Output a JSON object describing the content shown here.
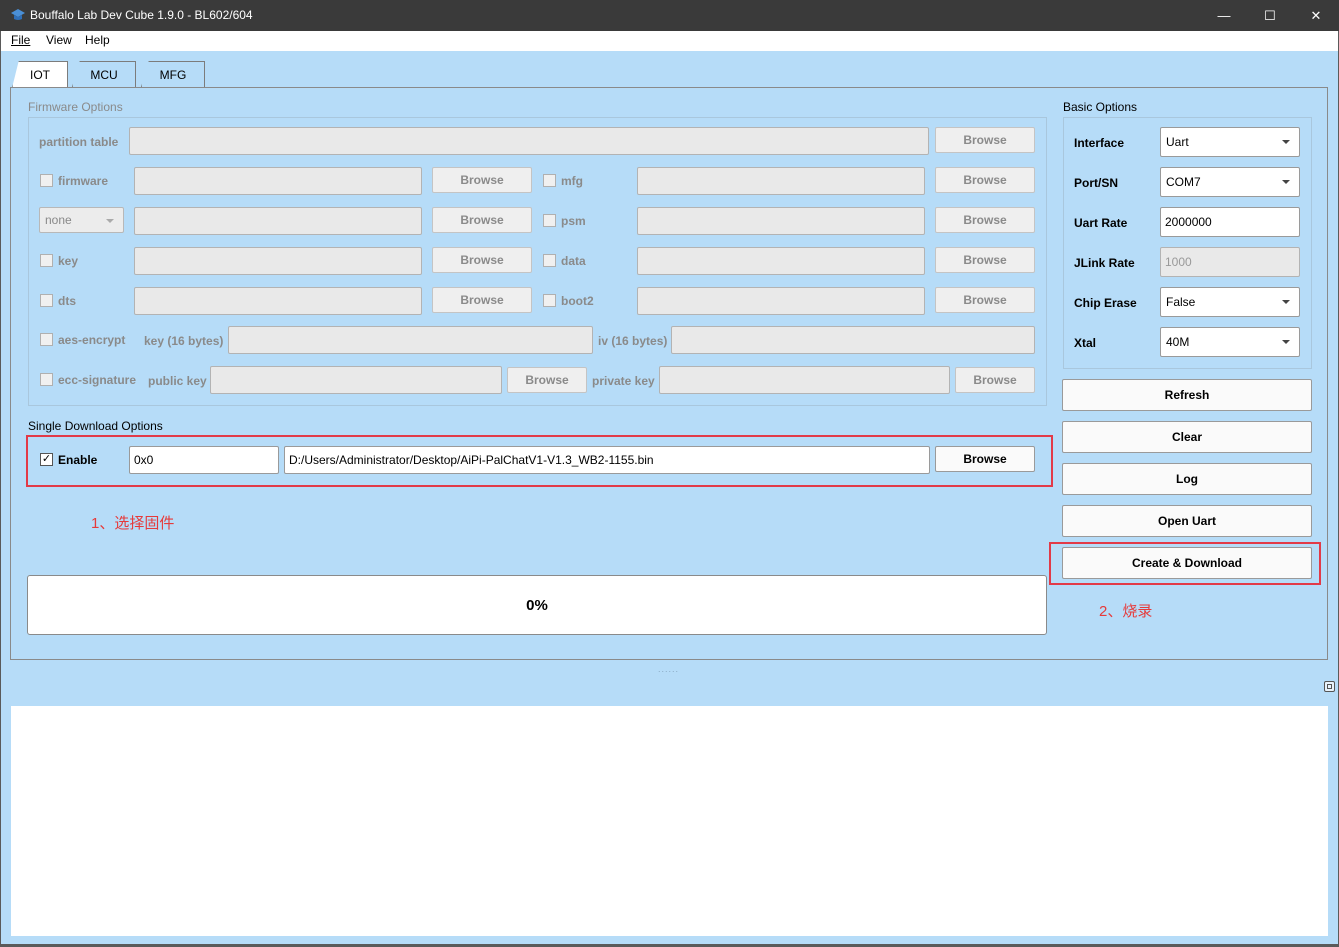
{
  "window": {
    "title": "Bouffalo Lab Dev Cube 1.9.0 - BL602/604",
    "minimize": "—",
    "maximize": "☐",
    "close": "✕"
  },
  "menu": {
    "file": "File",
    "view": "View",
    "help": "Help"
  },
  "tabs": [
    {
      "label": "IOT",
      "active": true
    },
    {
      "label": "MCU",
      "active": false
    },
    {
      "label": "MFG",
      "active": false
    }
  ],
  "firmware_options": {
    "title": "Firmware Options",
    "partition_table": {
      "label": "partition table",
      "value": "",
      "browse": "Browse"
    },
    "firmware": {
      "label": "firmware",
      "checked": false,
      "value": "",
      "browse": "Browse"
    },
    "mfg": {
      "label": "mfg",
      "checked": false,
      "value": "",
      "browse": "Browse"
    },
    "none_select": {
      "value": "none",
      "field": "",
      "browse": "Browse"
    },
    "psm": {
      "label": "psm",
      "checked": false,
      "value": "",
      "browse": "Browse"
    },
    "key": {
      "label": "key",
      "checked": false,
      "value": "",
      "browse": "Browse"
    },
    "data": {
      "label": "data",
      "checked": false,
      "value": "",
      "browse": "Browse"
    },
    "dts": {
      "label": "dts",
      "checked": false,
      "value": "",
      "browse": "Browse"
    },
    "boot2": {
      "label": "boot2",
      "checked": false,
      "value": "",
      "browse": "Browse"
    },
    "aes_encrypt": {
      "label": "aes-encrypt",
      "checked": false,
      "key_label": "key (16 bytes)",
      "key_value": "",
      "iv_label": "iv (16 bytes)",
      "iv_value": ""
    },
    "ecc_signature": {
      "label": "ecc-signature",
      "checked": false,
      "public_label": "public key",
      "public_value": "",
      "public_browse": "Browse",
      "private_label": "private key",
      "private_value": "",
      "private_browse": "Browse"
    }
  },
  "basic_options": {
    "title": "Basic Options",
    "interface": {
      "label": "Interface",
      "value": "Uart"
    },
    "port": {
      "label": "Port/SN",
      "value": "COM7"
    },
    "uart_rate": {
      "label": "Uart Rate",
      "value": "2000000"
    },
    "jlink_rate": {
      "label": "JLink Rate",
      "value": "1000"
    },
    "chip_erase": {
      "label": "Chip Erase",
      "value": "False"
    },
    "xtal": {
      "label": "Xtal",
      "value": "40M"
    }
  },
  "single_download": {
    "title": "Single Download Options",
    "enable_label": "Enable",
    "enabled": true,
    "check_mark": "✓",
    "address": "0x0",
    "path": "D:/Users/Administrator/Desktop/AiPi-PalChatV1-V1.3_WB2-1155.bin",
    "browse": "Browse"
  },
  "actions": {
    "refresh": "Refresh",
    "clear": "Clear",
    "log": "Log",
    "open_uart": "Open Uart",
    "create_download": "Create & Download"
  },
  "progress": {
    "text": "0%",
    "value": 0
  },
  "annotations": {
    "step1": "1、选择固件",
    "step2": "2、烧录"
  },
  "splitter": "......",
  "colors": {
    "panel_bg": "#b6dcf8",
    "titlebar": "#3a3a3a",
    "annotation_red": "#e63a3a"
  }
}
